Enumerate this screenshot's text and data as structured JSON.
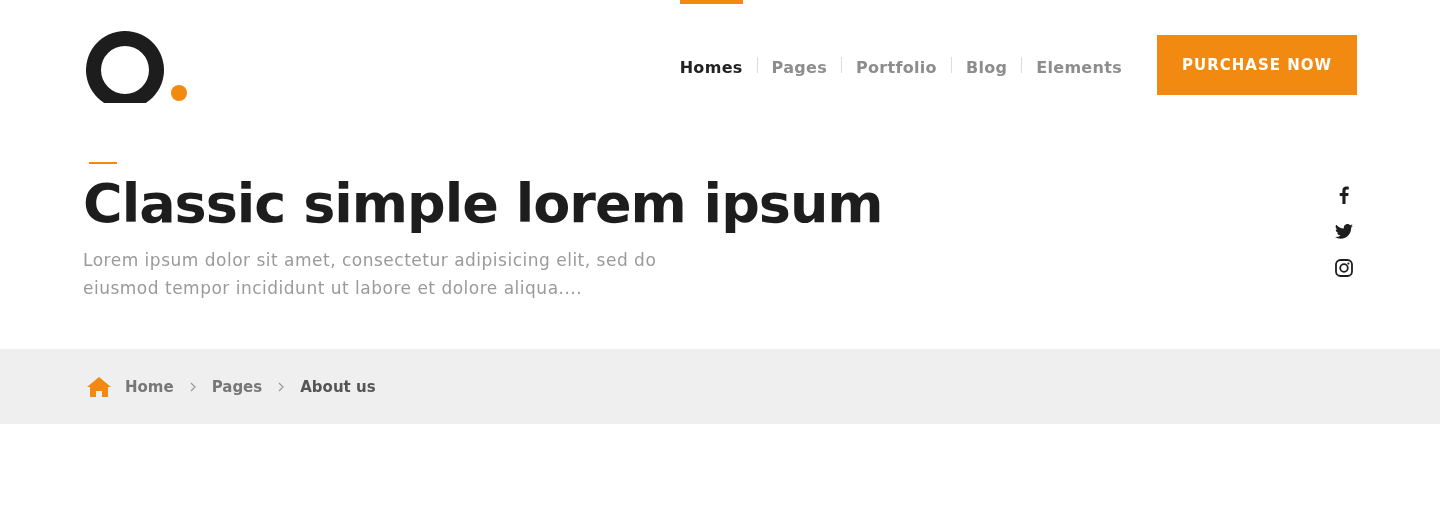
{
  "nav": {
    "items": [
      {
        "label": "Homes",
        "selected": true
      },
      {
        "label": "Pages",
        "selected": false
      },
      {
        "label": "Portfolio",
        "selected": false
      },
      {
        "label": "Blog",
        "selected": false
      },
      {
        "label": "Elements",
        "selected": false
      }
    ],
    "button": "PURCHASE NOW"
  },
  "hero": {
    "title": "Classic simple lorem ipsum",
    "text": "Lorem ipsum dolor sit amet, consectetur adipisicing elit, sed do eiusmod tempor incididunt ut labore et dolore aliqua...."
  },
  "breadcrumb": [
    "Home",
    "Pages",
    "About us"
  ]
}
